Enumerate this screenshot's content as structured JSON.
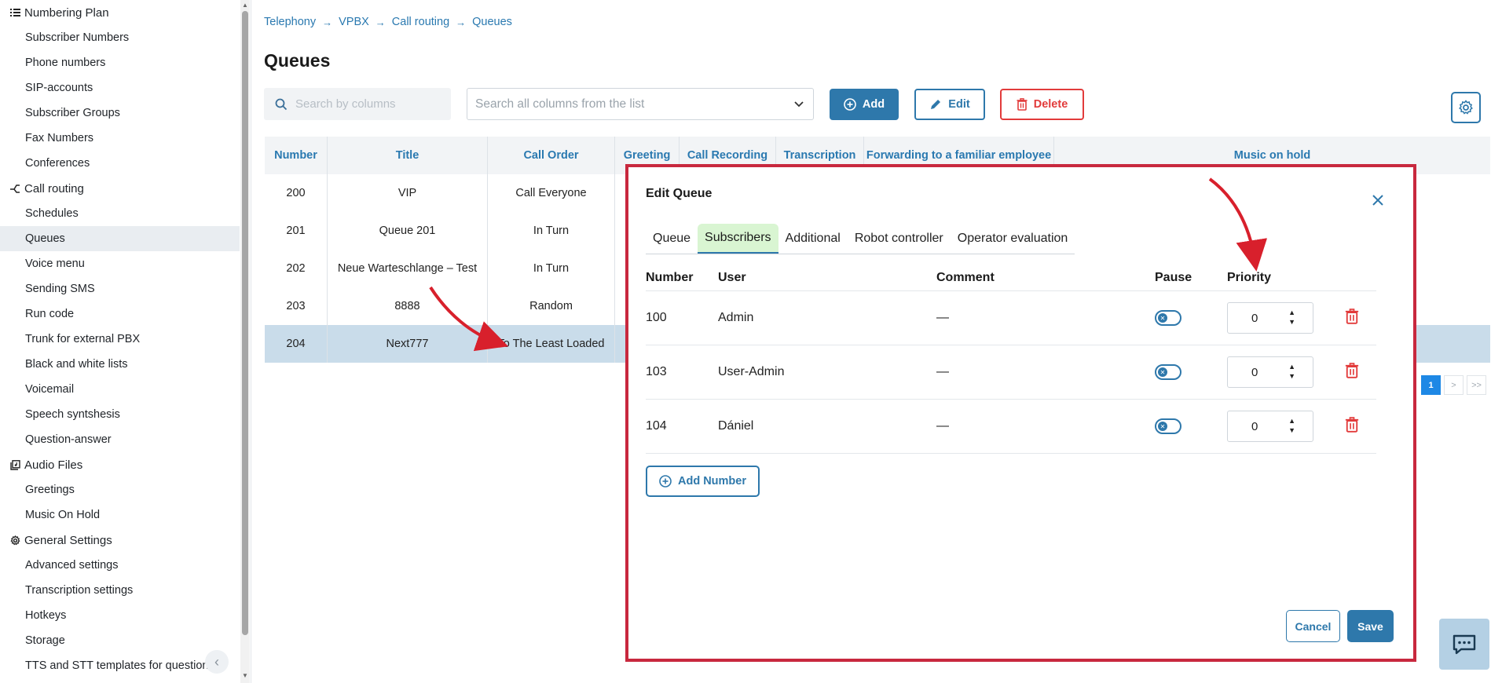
{
  "sidebar": {
    "items": [
      {
        "label": "Numbering Plan",
        "type": "section",
        "icon": "list-icon"
      },
      {
        "label": "Subscriber Numbers",
        "type": "item"
      },
      {
        "label": "Phone numbers",
        "type": "item"
      },
      {
        "label": "SIP-accounts",
        "type": "item"
      },
      {
        "label": "Subscriber Groups",
        "type": "item"
      },
      {
        "label": "Fax Numbers",
        "type": "item"
      },
      {
        "label": "Conferences",
        "type": "item"
      },
      {
        "label": "Call routing",
        "type": "section",
        "icon": "routing-icon"
      },
      {
        "label": "Schedules",
        "type": "item"
      },
      {
        "label": "Queues",
        "type": "item",
        "active": true
      },
      {
        "label": "Voice menu",
        "type": "item"
      },
      {
        "label": "Sending SMS",
        "type": "item"
      },
      {
        "label": "Run code",
        "type": "item"
      },
      {
        "label": "Trunk for external PBX",
        "type": "item"
      },
      {
        "label": "Black and white lists",
        "type": "item"
      },
      {
        "label": "Voicemail",
        "type": "item"
      },
      {
        "label": "Speech syntshesis",
        "type": "item"
      },
      {
        "label": "Question-answer",
        "type": "item"
      },
      {
        "label": "Audio Files",
        "type": "section",
        "icon": "audio-files-icon"
      },
      {
        "label": "Greetings",
        "type": "item"
      },
      {
        "label": "Music On Hold",
        "type": "item"
      },
      {
        "label": "General Settings",
        "type": "section",
        "icon": "gear-icon"
      },
      {
        "label": "Advanced settings",
        "type": "item"
      },
      {
        "label": "Transcription settings",
        "type": "item"
      },
      {
        "label": "Hotkeys",
        "type": "item"
      },
      {
        "label": "Storage",
        "type": "item"
      },
      {
        "label": "TTS and STT templates for question-",
        "type": "item"
      }
    ]
  },
  "breadcrumb": [
    "Telephony",
    "VPBX",
    "Call routing",
    "Queues"
  ],
  "page_title": "Queues",
  "toolbar": {
    "search_placeholder": "Search by columns",
    "column_select_placeholder": "Search all columns from the list",
    "add_label": "Add",
    "edit_label": "Edit",
    "delete_label": "Delete"
  },
  "table": {
    "columns": [
      "Number",
      "Title",
      "Call Order",
      "Greeting",
      "Call Recording",
      "Transcription",
      "Forwarding to a familiar employee",
      "Music on hold"
    ],
    "rows": [
      {
        "number": "200",
        "title": "VIP",
        "call_order": "Call Everyone"
      },
      {
        "number": "201",
        "title": "Queue 201",
        "call_order": "In Turn"
      },
      {
        "number": "202",
        "title": "Neue Warteschlange – Test",
        "call_order": "In Turn"
      },
      {
        "number": "203",
        "title": "8888",
        "call_order": "Random"
      },
      {
        "number": "204",
        "title": "Next777",
        "call_order": "To The Least Loaded",
        "selected": true
      }
    ]
  },
  "pagination": {
    "current": "1",
    "next": ">",
    "last": ">>"
  },
  "modal": {
    "title": "Edit Queue",
    "tabs": [
      "Queue",
      "Subscribers",
      "Additional",
      "Robot controller",
      "Operator evaluation"
    ],
    "active_tab": "Subscribers",
    "columns": [
      "Number",
      "User",
      "Comment",
      "Pause",
      "Priority"
    ],
    "rows": [
      {
        "number": "100",
        "user": "Admin",
        "comment": "—",
        "pause": false,
        "priority": "0"
      },
      {
        "number": "103",
        "user": "User-Admin",
        "comment": "—",
        "pause": false,
        "priority": "0"
      },
      {
        "number": "104",
        "user": "Dániel",
        "comment": "—",
        "pause": false,
        "priority": "0"
      }
    ],
    "add_number_label": "Add Number",
    "cancel_label": "Cancel",
    "save_label": "Save"
  },
  "colors": {
    "accent": "#2e78ab",
    "danger": "#e23b3b",
    "annotation": "#c8283e",
    "active_tab": "#d9f5d2",
    "selected_row": "#c9dcea"
  }
}
